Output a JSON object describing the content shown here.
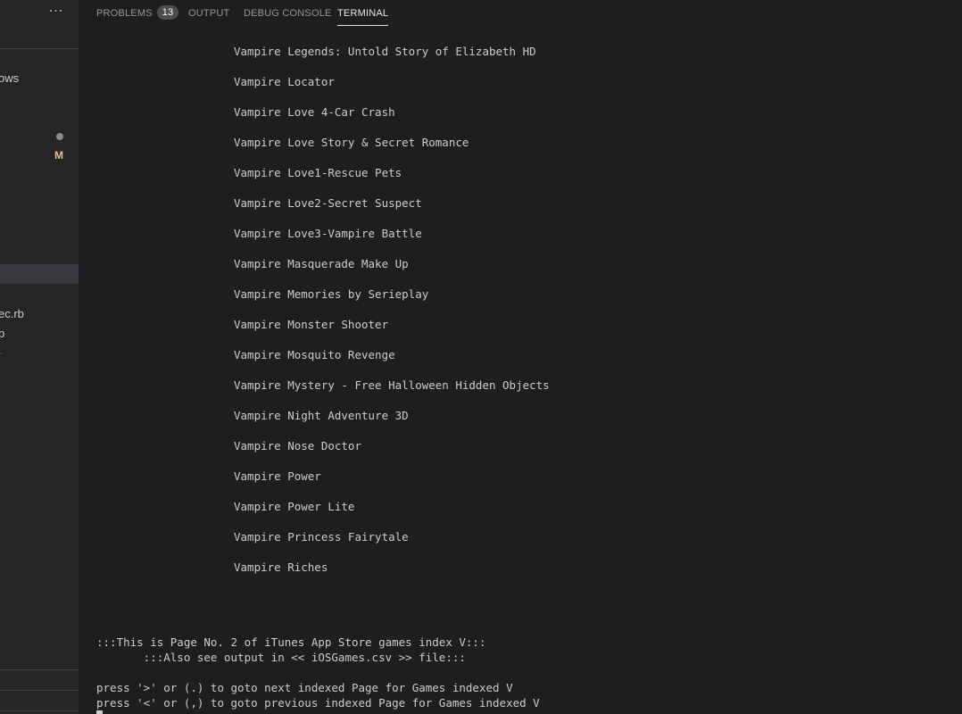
{
  "sidebar": {
    "more_label": "···",
    "items": [
      {
        "label": "ows"
      },
      {
        "label": "ec.rb"
      },
      {
        "label": "b"
      }
    ],
    "modified_badge": "M"
  },
  "panel": {
    "tabs": [
      {
        "label": "PROBLEMS",
        "badge": "13"
      },
      {
        "label": "OUTPUT"
      },
      {
        "label": "DEBUG CONSOLE"
      },
      {
        "label": "TERMINAL",
        "active": true
      }
    ]
  },
  "terminal": {
    "games": [
      "Vampire Legends: Untold Story of Elizabeth HD",
      "Vampire Locator",
      "Vampire Love 4-Car Crash",
      "Vampire Love Story & Secret Romance",
      "Vampire Love1-Rescue Pets",
      "Vampire Love2-Secret Suspect",
      "Vampire Love3-Vampire Battle",
      "Vampire Masquerade Make Up",
      "Vampire Memories by Serieplay",
      "Vampire Monster Shooter",
      "Vampire Mosquito Revenge",
      "Vampire Mystery - Free Halloween Hidden Objects",
      "Vampire Night Adventure 3D",
      "Vampire Nose Doctor",
      "Vampire Power",
      "Vampire Power Lite",
      "Vampire Princess Fairytale",
      "Vampire Riches"
    ],
    "footer": [
      ":::This is Page No. 2 of iTunes App Store games index V:::",
      "       :::Also see output in << iOSGames.csv >> file:::",
      "",
      "press '>' or (.) to goto next indexed Page for Games indexed V",
      "press '<' or (,) to goto previous indexed Page for Games indexed V"
    ]
  }
}
